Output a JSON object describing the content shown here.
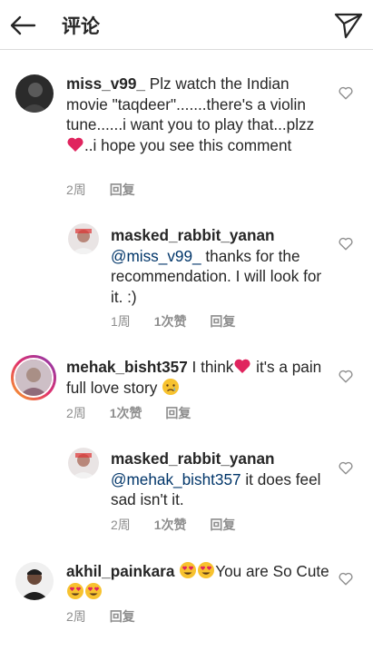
{
  "header": {
    "title": "评论"
  },
  "comments": [
    {
      "username": "miss_v99_",
      "text_a": "Plz watch the Indian movie \"taqdeer\".......there's a violin tune......i want you to play that...plzz",
      "text_b": "..i hope you see this comment",
      "time": "2周",
      "reply": "回复"
    },
    {
      "username": "masked_rabbit_yanan",
      "mention": "@miss_v99_",
      "text": "thanks for the recommendation. I will look for it. :)",
      "time": "1周",
      "likes": "1次赞",
      "reply": "回复"
    },
    {
      "username": "mehak_bisht357",
      "text_a": "I think",
      "text_b": "it's a pain full love story",
      "time": "2周",
      "likes": "1次赞",
      "reply": "回复"
    },
    {
      "username": "masked_rabbit_yanan",
      "mention": "@mehak_bisht357",
      "text": "it does feel sad isn't it.",
      "time": "2周",
      "likes": "1次赞",
      "reply": "回复"
    },
    {
      "username": "akhil_painkara",
      "text_a": "You are So Cute",
      "time": "2周",
      "reply": "回复"
    }
  ],
  "icons": {
    "back": "back-arrow-icon",
    "send": "send-direct-icon",
    "like": "heart-outline-icon"
  },
  "colors": {
    "heart_red": "#e0245e",
    "mention_blue": "#003569",
    "meta_gray": "#8e8e8e",
    "divider": "#dbdbdb"
  }
}
